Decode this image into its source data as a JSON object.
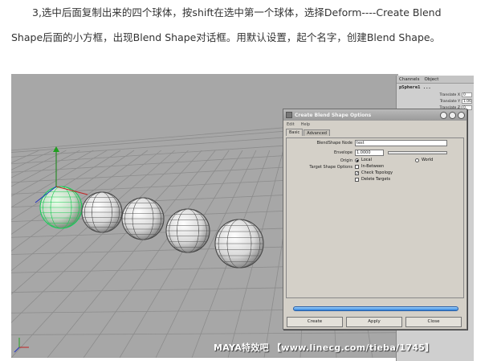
{
  "article": {
    "line1": "3,选中后面复制出来的四个球体，按shift在选中第一个球体，选择Deform----Create Blend",
    "line2": "Shape后面的小方框，出现Blend Shape对话框。用默认设置，起个名字，创建Blend Shape。"
  },
  "channel_box": {
    "tabs": [
      "Channels",
      "Object"
    ],
    "object_name": "pSphere1 ...",
    "rows": [
      {
        "label": "Translate X",
        "value": "0"
      },
      {
        "label": "Translate Y",
        "value": "1.06"
      },
      {
        "label": "Translate Z",
        "value": "0"
      }
    ]
  },
  "dialog": {
    "title": "Create Blend Shape Options",
    "menus": [
      "Edit",
      "Help"
    ],
    "tabs": [
      "Basic",
      "Advanced"
    ],
    "blendshape_node_label": "BlendShape Node",
    "blendshape_node_value": "test",
    "envelope_label": "Envelope",
    "envelope_value": "1.0000",
    "envelope_level": 1.0,
    "origin_label": "Origin",
    "origin_local": "Local",
    "origin_world": "World",
    "target_label": "Target Shape Options",
    "in_between": "In-Between",
    "check_topology": "Check Topology",
    "delete_targets": "Delete Targets",
    "buttons": {
      "create": "Create",
      "apply": "Apply",
      "close": "Close"
    }
  },
  "watermark": "MAYA特效吧 【www.linecg.com/tieba/1745】",
  "icons": [
    "window-icon",
    "minimize-icon",
    "maximize-icon",
    "close-icon",
    "move-manipulator-icon"
  ]
}
